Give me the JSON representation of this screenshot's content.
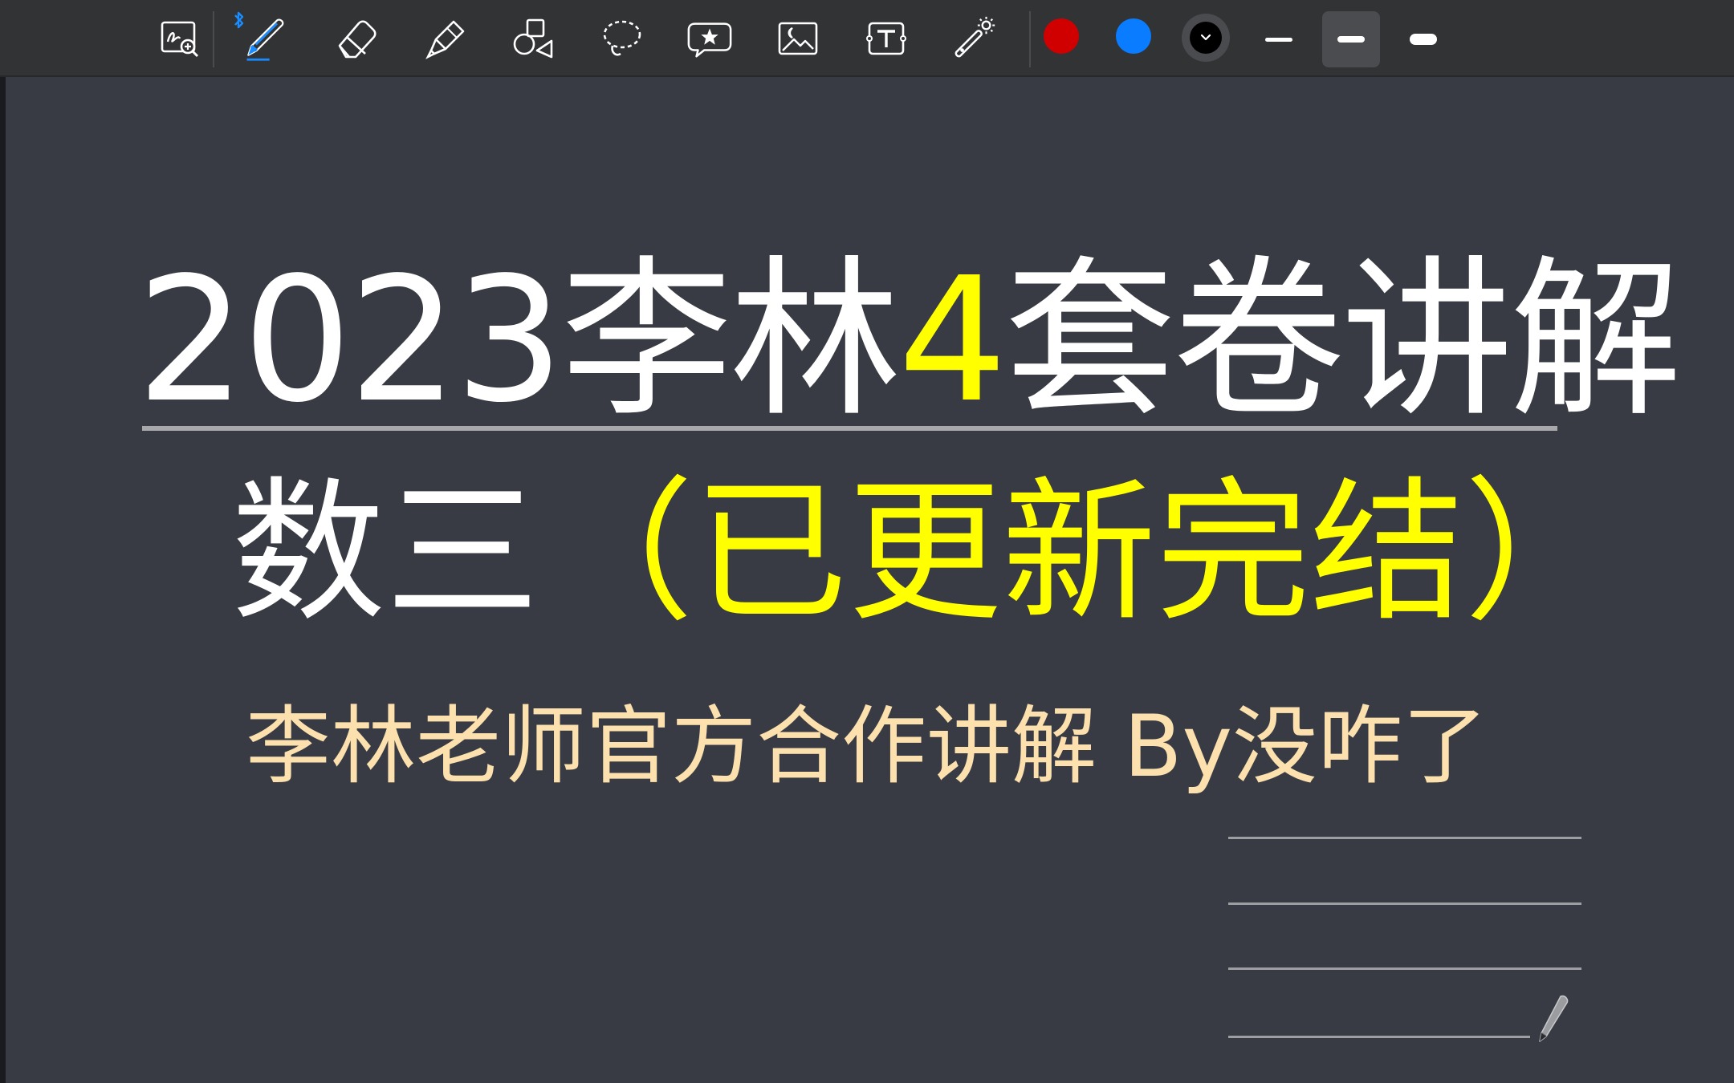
{
  "toolbar": {
    "tools": [
      {
        "name": "zoom-handwriting-icon",
        "label": ""
      },
      {
        "name": "pen-icon",
        "label": ""
      },
      {
        "name": "eraser-icon",
        "label": ""
      },
      {
        "name": "highlighter-icon",
        "label": ""
      },
      {
        "name": "shapes-icon",
        "label": ""
      },
      {
        "name": "lasso-icon",
        "label": ""
      },
      {
        "name": "sticker-star-icon",
        "label": ""
      },
      {
        "name": "image-icon",
        "label": ""
      },
      {
        "name": "text-box-icon",
        "label": ""
      },
      {
        "name": "laser-pointer-icon",
        "label": ""
      }
    ],
    "bluetooth_icon": "bluetooth-icon",
    "colors": {
      "red": "#d10000",
      "blue": "#0a7cff",
      "black": "#000000"
    },
    "stroke_widths": [
      "thin",
      "medium",
      "thick"
    ],
    "selected_width": "medium"
  },
  "slide": {
    "title_part1": "2023李林",
    "title_highlight": "4",
    "title_part2": "套卷讲解",
    "subtitle_part1": "数三",
    "subtitle_highlight": "（已更新完结）",
    "byline": "李林老师官方合作讲解 By没咋了",
    "colors": {
      "background": "#383b43",
      "title": "#ffffff",
      "highlight": "#ffff00",
      "byline": "#fce0ad"
    }
  }
}
